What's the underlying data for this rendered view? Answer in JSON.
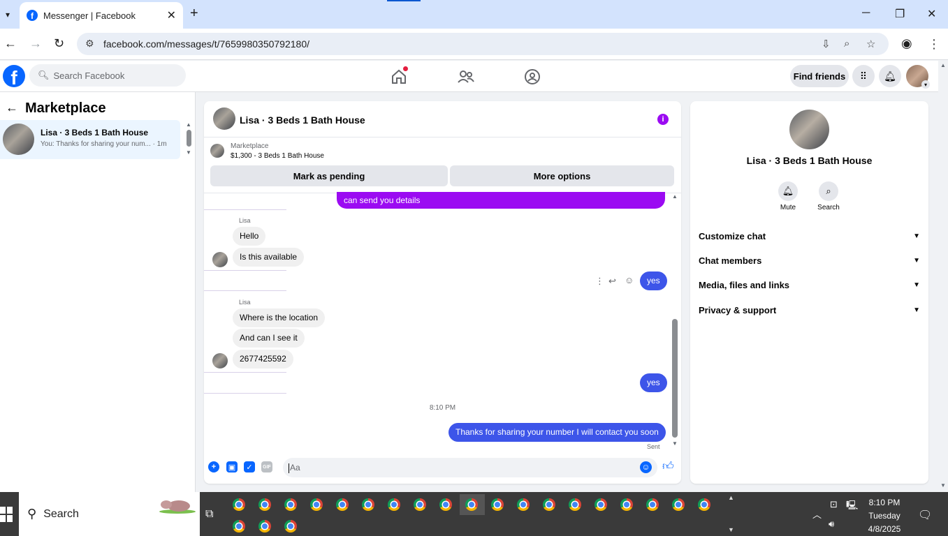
{
  "browser": {
    "tab_title": "Messenger | Facebook",
    "url": "facebook.com/messages/t/7659980350792180/"
  },
  "fb_header": {
    "search_placeholder": "Search Facebook",
    "find_friends": "Find friends"
  },
  "left_panel": {
    "title": "Marketplace",
    "conversations": [
      {
        "name": "Lisa · 3 Beds 1 Bath House",
        "snippet": "You: Thanks for sharing your num...",
        "time": "· 1m"
      }
    ]
  },
  "chat": {
    "header_name": "Lisa · 3 Beds 1 Bath House",
    "marketplace_label": "Marketplace",
    "listing": "$1,300 - 3 Beds 1 Bath House",
    "mark_pending": "Mark as pending",
    "more_options": "More options",
    "messages": {
      "top_partial": "can send you  details",
      "sender1": "Lisa",
      "hello": "Hello",
      "available": "Is this available",
      "yes1": "yes",
      "sender2": "Lisa",
      "location": "Where is the location",
      "see_it": "And can I see it",
      "phone": "2677425592",
      "yes2": "yes",
      "time": "8:10 PM",
      "thanks": "Thanks for sharing your number I will contact you soon",
      "sent": "Sent"
    },
    "composer_placeholder": "Aa",
    "gif_label": "GIF"
  },
  "right_panel": {
    "name": "Lisa · 3 Beds 1 Bath House",
    "mute": "Mute",
    "search": "Search",
    "sections": [
      "Customize chat",
      "Chat members",
      "Media, files and links",
      "Privacy & support"
    ]
  },
  "taskbar": {
    "search": "Search",
    "time": "8:10 PM",
    "day": "Tuesday",
    "date": "4/8/2025"
  }
}
